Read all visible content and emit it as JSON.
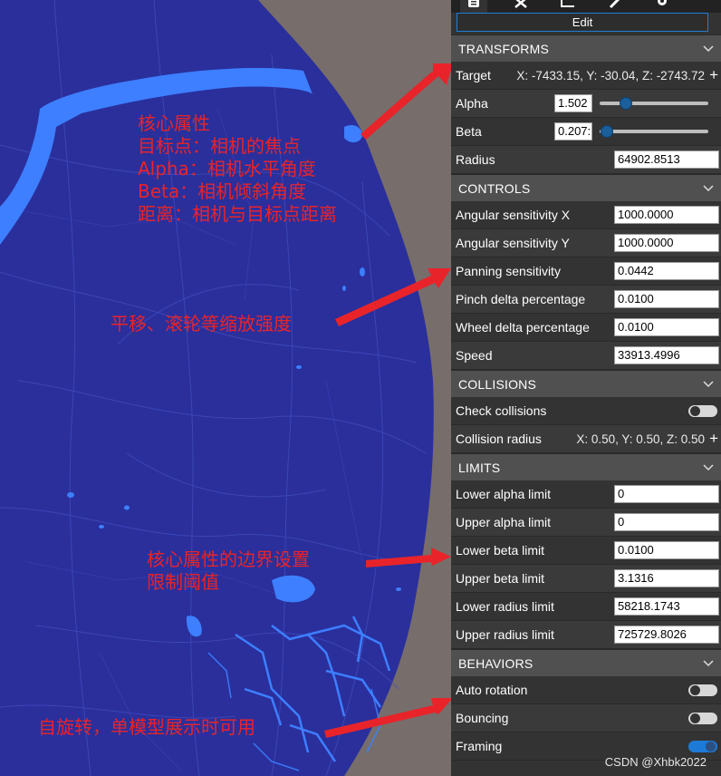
{
  "annotations": {
    "core": {
      "lines": [
        "核心属性",
        "目标点：相机的焦点",
        "Alpha：相机水平角度",
        "Beta：相机倾斜角度",
        "距离：相机与目标点距离"
      ]
    },
    "sensitivity": "平移、滚轮等缩放强度",
    "limits": {
      "lines": [
        "核心属性的边界设置",
        "限制阈值"
      ]
    },
    "rotation": "自旋转，单模型展示时可用"
  },
  "watermark": "CSDN @Xhbk2022",
  "toolbar": {
    "tabs": [
      "document-icon",
      "pointer-icon",
      "chart-icon",
      "pencil-icon",
      "gear-icon"
    ],
    "edit_label": "Edit"
  },
  "transforms": {
    "title": "TRANSFORMS",
    "target_label": "Target",
    "target_value": "X: -7433.15, Y: -30.04, Z: -2743.72",
    "alpha_label": "Alpha",
    "alpha_value": "1.502",
    "alpha_slider": 0.24,
    "beta_label": "Beta",
    "beta_value": "0.207:",
    "beta_slider": 0.07,
    "radius_label": "Radius",
    "radius_value": "64902.8513"
  },
  "controls": {
    "title": "CONTROLS",
    "rows": [
      {
        "label": "Angular sensitivity X",
        "value": "1000.0000"
      },
      {
        "label": "Angular sensitivity Y",
        "value": "1000.0000"
      },
      {
        "label": "Panning sensitivity",
        "value": "0.0442"
      },
      {
        "label": "Pinch delta percentage",
        "value": "0.0100"
      },
      {
        "label": "Wheel delta percentage",
        "value": "0.0100"
      },
      {
        "label": "Speed",
        "value": "33913.4996"
      }
    ]
  },
  "collisions": {
    "title": "COLLISIONS",
    "check_label": "Check collisions",
    "check_on": false,
    "radius_label": "Collision radius",
    "radius_value": "X: 0.50, Y: 0.50, Z: 0.50"
  },
  "limits": {
    "title": "LIMITS",
    "rows": [
      {
        "label": "Lower alpha limit",
        "value": "0"
      },
      {
        "label": "Upper alpha limit",
        "value": "0"
      },
      {
        "label": "Lower beta limit",
        "value": "0.0100"
      },
      {
        "label": "Upper beta limit",
        "value": "3.1316"
      },
      {
        "label": "Lower radius limit",
        "value": "58218.1743"
      },
      {
        "label": "Upper radius limit",
        "value": "725729.8026"
      }
    ]
  },
  "behaviors": {
    "title": "BEHAVIORS",
    "rows": [
      {
        "label": "Auto rotation",
        "on": false
      },
      {
        "label": "Bouncing",
        "on": false
      },
      {
        "label": "Framing",
        "on": true
      }
    ]
  },
  "colors": {
    "map_land": "#2a2f9c",
    "map_water": "#3d7fff",
    "annotation": "#e8242a",
    "accent": "#1e7fd6"
  }
}
